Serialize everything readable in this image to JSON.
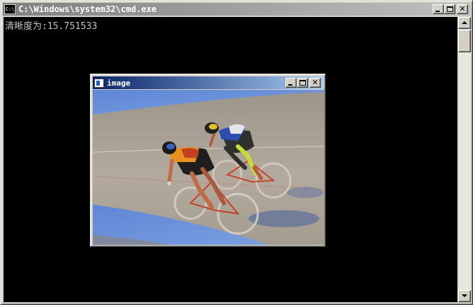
{
  "console": {
    "title": "C:\\Windows\\system32\\cmd.exe",
    "icon_text": "C:\\",
    "output_line": "清晰度为:15.751533",
    "icon_names": {
      "app": "cmd-icon",
      "minimize": "minimize-icon",
      "maximize": "maximize-icon",
      "close": "close-icon"
    }
  },
  "image_window": {
    "title": "image",
    "photo_subject": "two track cyclists racing on a velodrome"
  },
  "colors": {
    "console_background": "#000000",
    "console_text": "#c0c0c0",
    "active_title_start": "#0a246a",
    "active_title_end": "#a6caf0",
    "inactive_title_start": "#808080",
    "inactive_title_end": "#c0c0c0",
    "chrome": "#d4d0c8"
  }
}
